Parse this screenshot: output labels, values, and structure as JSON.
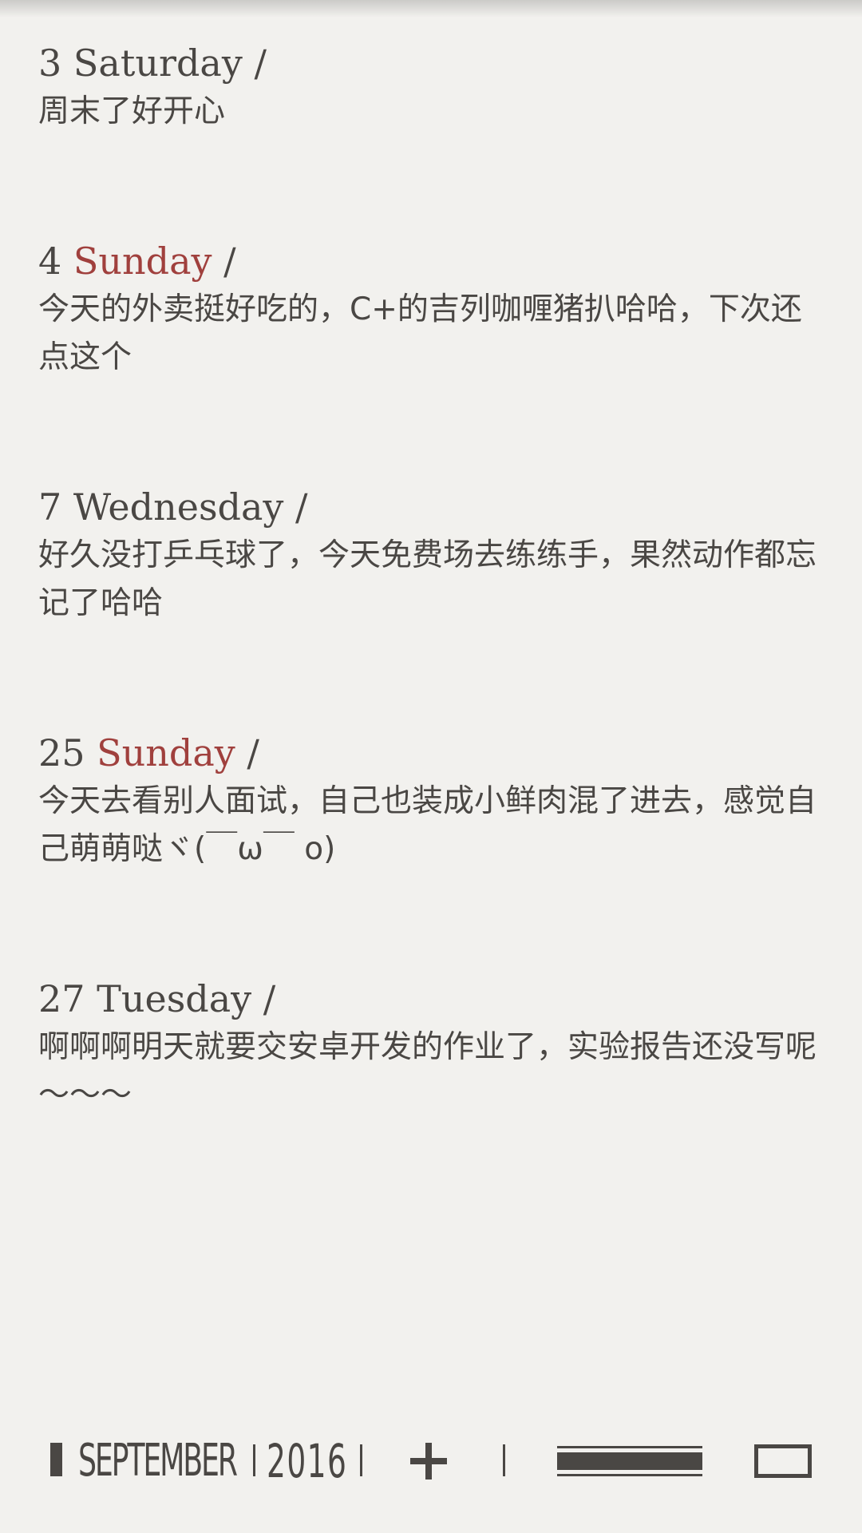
{
  "entries": [
    {
      "num": "3",
      "day": "Saturday",
      "slash": "/",
      "weekend": false,
      "text": "周末了好开心"
    },
    {
      "num": "4",
      "day": "Sunday",
      "slash": "/",
      "weekend": true,
      "text": "今天的外卖挺好吃的，C+的吉列咖喱猪扒哈哈，下次还点这个"
    },
    {
      "num": "7",
      "day": "Wednesday",
      "slash": "/",
      "weekend": false,
      "text": "好久没打乒乓球了，今天免费场去练练手，果然动作都忘记了哈哈"
    },
    {
      "num": "25",
      "day": "Sunday",
      "slash": "/",
      "weekend": true,
      "text": "今天去看别人面试，自己也装成小鲜肉混了进去，感觉自己萌萌哒ヾ(￣ω￣ o)"
    },
    {
      "num": "27",
      "day": "Tuesday",
      "slash": "/",
      "weekend": false,
      "text": "啊啊啊明天就要交安卓开发的作业了，实验报告还没写呢～～～"
    }
  ],
  "bottom_bar": {
    "month": "SEPTEMBER",
    "year": "2016"
  },
  "colors": {
    "background": "#f2f1ee",
    "text": "#4a4744",
    "weekend_accent": "#a0403d"
  },
  "icons": {
    "add": "plus-icon",
    "list_view": "list-view-icon",
    "single_view": "single-view-icon"
  }
}
